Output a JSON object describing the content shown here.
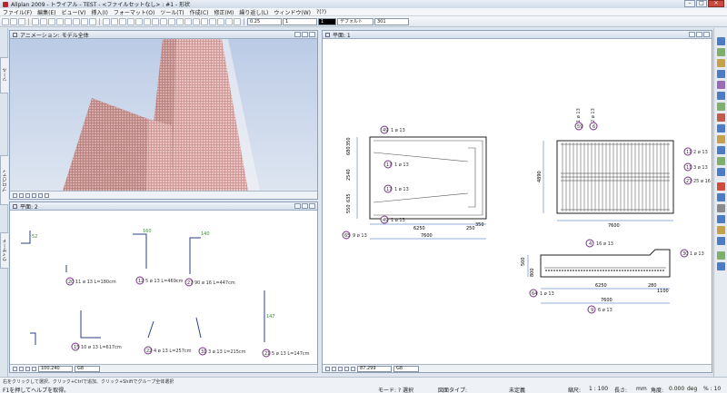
{
  "window": {
    "title": "Allplan 2009 - トライアル - TEST - <ファイルセットなし> : #1 - 形状"
  },
  "menu": [
    "ファイル(F)",
    "編集(E)",
    "ビュー(V)",
    "挿入(I)",
    "フォーマット(O)",
    "ツール(T)",
    "作成(C)",
    "修正(M)",
    "繰り返し(L)",
    "ウィンドウ(W)",
    "?(?)"
  ],
  "toolbar": {
    "line_weight": "0.25",
    "line_type": "1",
    "pen": "1",
    "pattern_label": "デフォルト",
    "layer": "301"
  },
  "left_tabs": [
    "ツール",
    "プロパティ",
    "ウィザード"
  ],
  "panes": {
    "anim": {
      "title": "アニメーション: モデル全体"
    },
    "plan2": {
      "title": "平面: 2",
      "scale": "100.240",
      "layer": "G8"
    },
    "plan1": {
      "title": "平面: 1",
      "scale": "87.299",
      "layer": "G8"
    }
  },
  "rebar_labels": {
    "l20": "11 ø 13  L=180cm",
    "l12": "5 ø 13  L=469cm",
    "l27": "90 ø 16  L=447cm",
    "l15": "10 ø 13  L=617cm",
    "l22": "4 ø 13  L=257cm",
    "l31": "3 ø 13  L=215cm",
    "l21": "5 ø 13  L=147cm",
    "dims_left": [
      "350",
      "680",
      "2540",
      "635",
      "550"
    ],
    "section_a": {
      "dim_total": "7600",
      "dim_sub": "6250",
      "dim_right": "250",
      "dim_right2": "350",
      "marks": [
        {
          "n": "49",
          "t": "1 ø 13"
        },
        {
          "n": "17",
          "t": "1 ø 13"
        },
        {
          "n": "17",
          "t": "1 ø 13"
        },
        {
          "n": "49",
          "t": "1 ø 13"
        },
        {
          "n": "65",
          "t": "9 ø 13"
        }
      ]
    },
    "section_b": {
      "dim_total": "7600",
      "dim_left": "4890",
      "marks": [
        {
          "n": "59",
          "t": "1 ø 13"
        },
        {
          "n": "6",
          "t": "2 ø 13"
        },
        {
          "n": "11",
          "t": "2 ø 13"
        },
        {
          "n": "11",
          "t": "3 ø 13"
        },
        {
          "n": "27",
          "t": "25 ø 16"
        }
      ]
    },
    "section_c": {
      "dim_total": "7600",
      "dim_sub": "6250",
      "dim_right": "280",
      "dim_right2": "1100",
      "dim_left": "500",
      "dim_left2": "800",
      "marks": [
        {
          "n": "4",
          "t": "16 ø 13"
        },
        {
          "n": "30",
          "t": "1 ø 13"
        },
        {
          "n": "64",
          "t": "1 ø 13"
        },
        {
          "n": "9",
          "t": "6 ø 13"
        }
      ]
    }
  },
  "statusbar": {
    "msg1": "右をクリックして選択、クリック+Ctrlで追加、クリック+Shiftでグループ全体選択",
    "msg2": "F1を押してヘルプを取得。",
    "mode": "モード: ? 選択",
    "drawing_type": "図面タイプ:",
    "unset": "未定義",
    "scale_label": "縮尺:",
    "scale": "1 : 100",
    "length_label": "長さ:",
    "length_unit": "mm",
    "angle_label": "角度:",
    "angle": "0.000",
    "angle_unit": "deg",
    "percent": "% : 10"
  },
  "colors": {
    "accent": "#7a2d8c",
    "building": "#d9a6a6",
    "sky": "#c7d4ea",
    "rebar": "#3a3a3a",
    "dim_line": "#2b5fb0"
  }
}
